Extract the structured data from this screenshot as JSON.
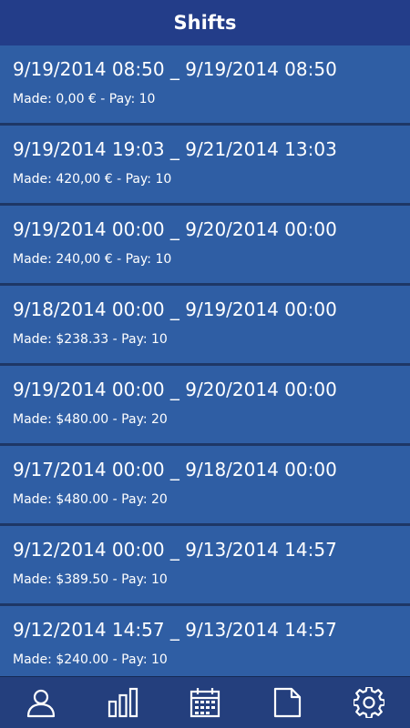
{
  "header": {
    "title": "Shifts"
  },
  "shifts": [
    {
      "range": "9/19/2014 08:50 _ 9/19/2014 08:50",
      "made": "Made: 0,00 € - Pay: 10"
    },
    {
      "range": "9/19/2014 19:03 _ 9/21/2014 13:03",
      "made": "Made: 420,00 € - Pay: 10"
    },
    {
      "range": "9/19/2014 00:00 _ 9/20/2014 00:00",
      "made": "Made: 240,00 € - Pay: 10"
    },
    {
      "range": "9/18/2014 00:00 _ 9/19/2014 00:00",
      "made": "Made: $238.33 - Pay: 10"
    },
    {
      "range": "9/19/2014 00:00 _ 9/20/2014 00:00",
      "made": "Made: $480.00 - Pay: 20"
    },
    {
      "range": "9/17/2014 00:00 _ 9/18/2014 00:00",
      "made": "Made: $480.00 - Pay: 20"
    },
    {
      "range": "9/12/2014 00:00 _ 9/13/2014 14:57",
      "made": "Made: $389.50 - Pay: 10"
    },
    {
      "range": "9/12/2014 14:57 _ 9/13/2014 14:57",
      "made": "Made: $240.00 - Pay: 10"
    }
  ],
  "tabs": [
    {
      "icon": "person-icon"
    },
    {
      "icon": "bar-chart-icon"
    },
    {
      "icon": "calendar-icon"
    },
    {
      "icon": "document-icon"
    },
    {
      "icon": "gear-icon"
    }
  ],
  "colors": {
    "header_bg": "#233d89",
    "row_bg": "#2f5ea4",
    "separator": "#1e3766",
    "tabbar_bg": "#243f7d",
    "text": "#ffffff"
  }
}
